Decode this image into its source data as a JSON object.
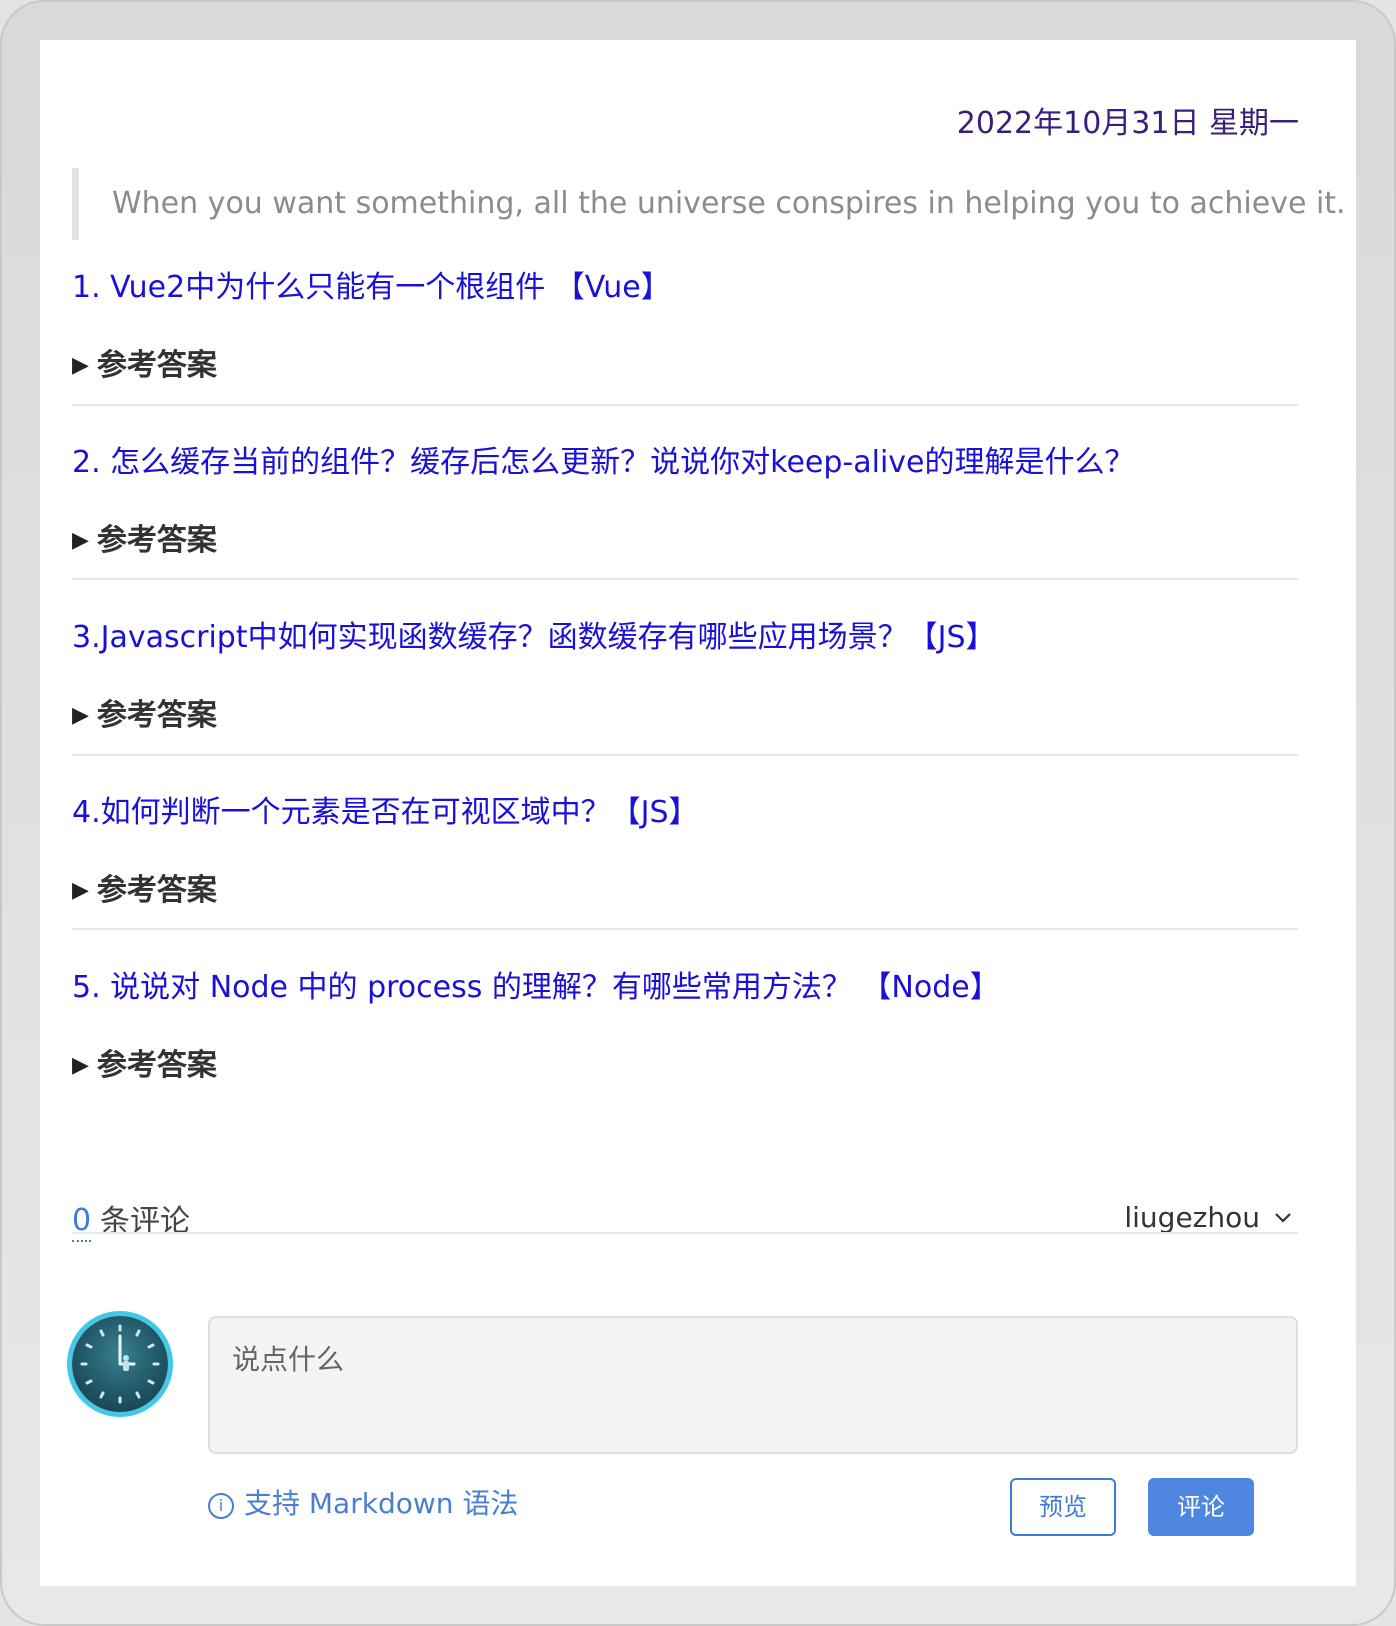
{
  "date": "2022年10月31日 星期一",
  "quote": "When you want something, all the universe conspires in helping you to achieve it.",
  "questions": [
    {
      "title": "1. Vue2中为什么只能有一个根组件 【Vue】",
      "answer_label": "参考答案"
    },
    {
      "title": "2. 怎么缓存当前的组件？缓存后怎么更新？说说你对keep-alive的理解是什么？",
      "answer_label": "参考答案"
    },
    {
      "title": "3.Javascript中如何实现函数缓存？函数缓存有哪些应用场景？【JS】",
      "answer_label": "参考答案"
    },
    {
      "title": "4.如何判断一个元素是否在可视区域中？【JS】",
      "answer_label": "参考答案"
    },
    {
      "title": "5. 说说对 Node 中的 process 的理解？有哪些常用方法？ 【Node】",
      "answer_label": "参考答案"
    }
  ],
  "comments": {
    "count": "0",
    "label": "条评论",
    "user": "liugezhou",
    "placeholder": "说点什么",
    "markdown_hint": "支持 Markdown 语法",
    "preview_button": "预览",
    "submit_button": "评论"
  },
  "colors": {
    "question_link": "#1a10d8",
    "accent": "#4f86e0",
    "date": "#3a1f7a"
  },
  "icons": {
    "answer_toggle": "triangle-right-icon",
    "user_menu": "chevron-down-icon",
    "info": "info-icon",
    "avatar": "clock-avatar"
  }
}
